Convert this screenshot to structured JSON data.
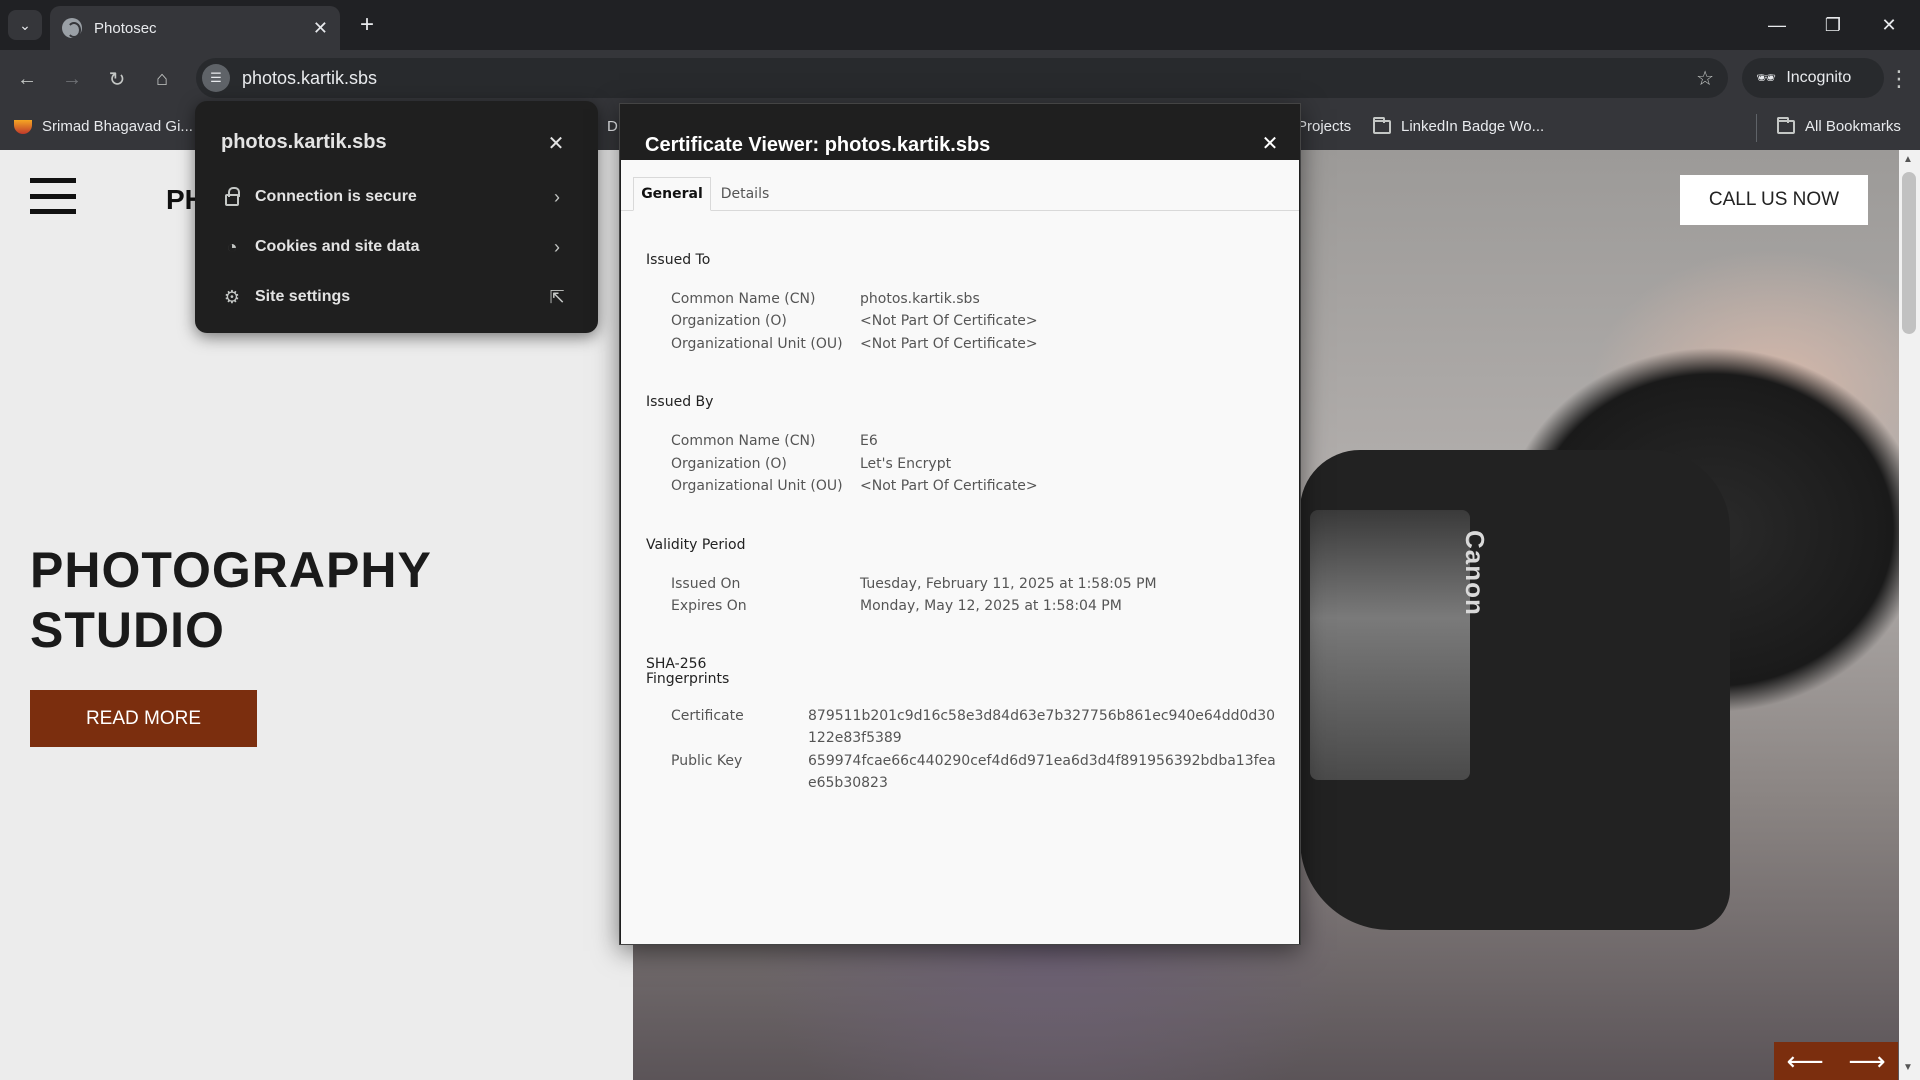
{
  "browser": {
    "tab_title": "Photosec",
    "url": "photos.kartik.sbs",
    "incognito_label": "Incognito",
    "new_tab_symbol": "+",
    "tab_close_symbol": "✕",
    "window_controls": {
      "minimize": "—",
      "restore": "❐",
      "close": "✕"
    }
  },
  "bookmarks": [
    {
      "label": "Srimad Bhagavad Gi...",
      "icon": "diya-icon"
    },
    {
      "label": "D",
      "icon": "none"
    },
    {
      "label": "Projects",
      "icon": "none"
    },
    {
      "label": "LinkedIn Badge Wo...",
      "icon": "folder-icon"
    },
    {
      "label": "All Bookmarks",
      "icon": "folder-icon"
    }
  ],
  "page": {
    "brand_partial": "PH",
    "call_button": "CALL US NOW",
    "hero_title_line1": "PHOTOGRAPHY",
    "hero_title_line2": "STUDIO",
    "read_more": "READ MORE",
    "prev_arrow": "⟵",
    "next_arrow": "⟶",
    "camera_brand": "Canon",
    "accent_color": "#7b2e0e"
  },
  "site_info": {
    "host": "photos.kartik.sbs",
    "items": [
      {
        "label": "Connection is secure",
        "icon": "lock-icon",
        "trailing": "chevron-right-icon"
      },
      {
        "label": "Cookies and site data",
        "icon": "cookie-icon",
        "trailing": "chevron-right-icon"
      },
      {
        "label": "Site settings",
        "icon": "gear-icon",
        "trailing": "external-link-icon"
      }
    ]
  },
  "certificate": {
    "title": "Certificate Viewer: photos.kartik.sbs",
    "tabs": [
      "General",
      "Details"
    ],
    "active_tab": "General",
    "issued_to": {
      "heading": "Issued To",
      "rows": [
        {
          "label": "Common Name (CN)",
          "value": "photos.kartik.sbs"
        },
        {
          "label": "Organization (O)",
          "value": "<Not Part Of Certificate>"
        },
        {
          "label": "Organizational Unit (OU)",
          "value": "<Not Part Of Certificate>"
        }
      ]
    },
    "issued_by": {
      "heading": "Issued By",
      "rows": [
        {
          "label": "Common Name (CN)",
          "value": "E6"
        },
        {
          "label": "Organization (O)",
          "value": "Let's Encrypt"
        },
        {
          "label": "Organizational Unit (OU)",
          "value": "<Not Part Of Certificate>"
        }
      ]
    },
    "validity": {
      "heading": "Validity Period",
      "rows": [
        {
          "label": "Issued On",
          "value": "Tuesday, February 11, 2025 at 1:58:05 PM"
        },
        {
          "label": "Expires On",
          "value": "Monday, May 12, 2025 at 1:58:04 PM"
        }
      ]
    },
    "fingerprints": {
      "heading_line1": "SHA-256",
      "heading_line2": "Fingerprints",
      "rows": [
        {
          "label": "Certificate",
          "value": "879511b201c9d16c58e3d84d63e7b327756b861ec940e64dd0d30122e83f5389"
        },
        {
          "label": "Public Key",
          "value": "659974fcae66c440290cef4d6d971ea6d3d4f891956392bdba13feae65b30823"
        }
      ]
    }
  }
}
